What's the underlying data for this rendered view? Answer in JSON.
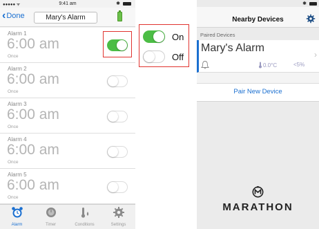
{
  "left": {
    "status": {
      "signal": "●●●●● ᯤ",
      "time": "9:41 am",
      "bluetooth": "✱"
    },
    "nav": {
      "back_label": "Done",
      "title": "Mary's Alarm"
    },
    "alarms": [
      {
        "label": "Alarm 1",
        "time": "6:00 am",
        "repeat": "Once",
        "enabled": true
      },
      {
        "label": "Alarm 2",
        "time": "6:00 am",
        "repeat": "Once",
        "enabled": false
      },
      {
        "label": "Alarm 3",
        "time": "6:00 am",
        "repeat": "Once",
        "enabled": false
      },
      {
        "label": "Alarm 4",
        "time": "6:00 am",
        "repeat": "Once",
        "enabled": false
      },
      {
        "label": "Alarm 5",
        "time": "6:00 am",
        "repeat": "Once",
        "enabled": false
      }
    ],
    "tabs": [
      {
        "label": "Alarm",
        "icon": "alarm-clock-icon",
        "active": true
      },
      {
        "label": "Timer",
        "icon": "timer-icon",
        "active": false
      },
      {
        "label": "Conditions",
        "icon": "thermometer-drop-icon",
        "active": false
      },
      {
        "label": "Settings",
        "icon": "gear-icon",
        "active": false
      }
    ]
  },
  "legend": {
    "on_label": "On",
    "off_label": "Off"
  },
  "right": {
    "status": {
      "bluetooth": "✱"
    },
    "nav": {
      "title": "Nearby Devices"
    },
    "section_header": "Paired Devices",
    "device": {
      "name": "Mary's Alarm",
      "temperature": "0.0°C",
      "humidity": "<5%",
      "chevron": "›"
    },
    "pair_button": "Pair New Device",
    "brand": "MARATHON"
  },
  "colors": {
    "accent": "#1a6fd0",
    "toggle_on": "#4cbd45",
    "highlight": "#e0332f"
  }
}
